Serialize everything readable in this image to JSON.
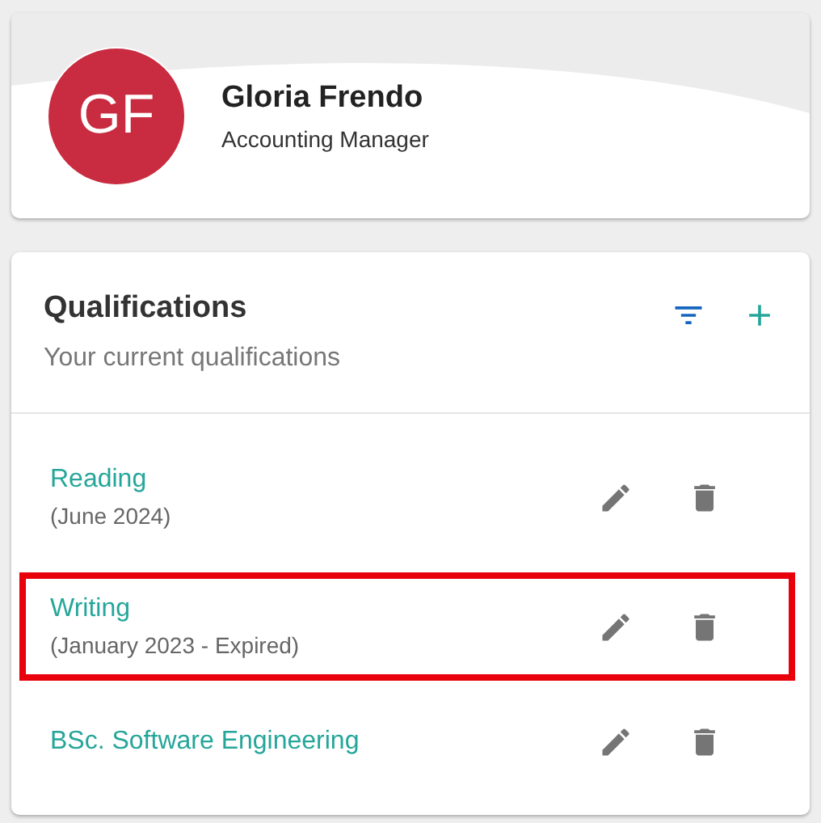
{
  "profile": {
    "initials": "GF",
    "name": "Gloria Frendo",
    "role": "Accounting Manager"
  },
  "qualifications": {
    "title": "Qualifications",
    "subtitle": "Your current qualifications",
    "items": [
      {
        "name": "Reading",
        "detail": "(June 2024)",
        "highlighted": false
      },
      {
        "name": "Writing",
        "detail": "(January 2023 - Expired)",
        "highlighted": true
      },
      {
        "name": "BSc. Software Engineering",
        "highlighted": false
      }
    ]
  }
}
